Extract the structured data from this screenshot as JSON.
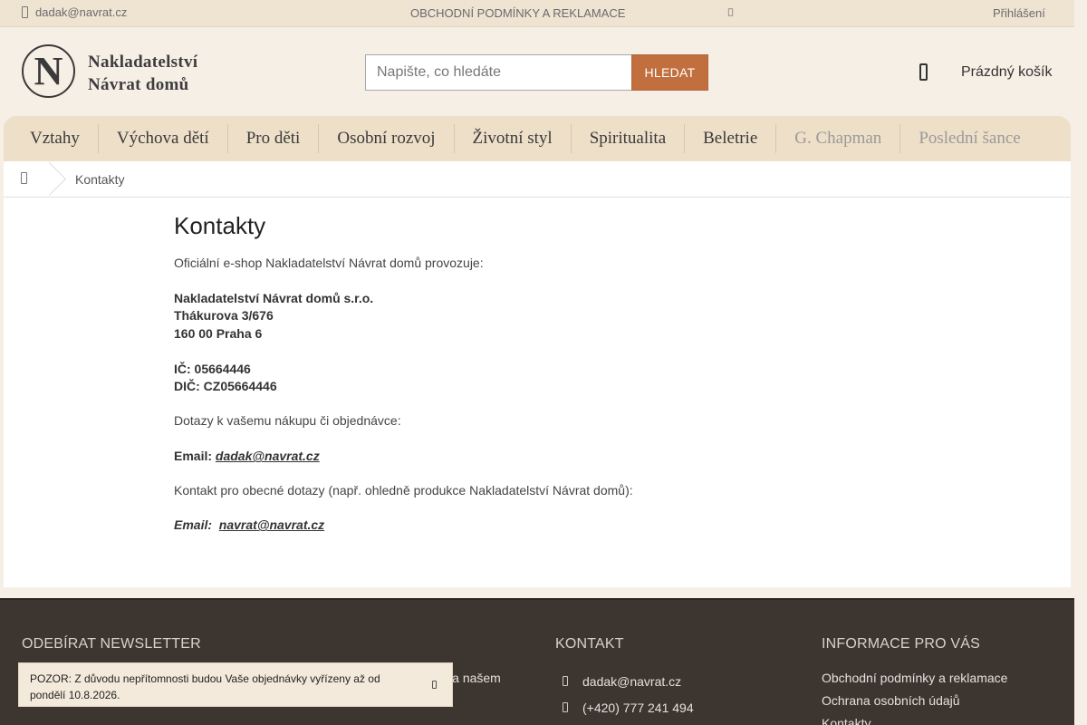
{
  "topbar": {
    "email": "dadak@navrat.cz",
    "terms": "OBCHODNÍ PODMÍNKY A REKLAMACE",
    "login": "Přihlášení"
  },
  "header": {
    "logo_letter": "N",
    "logo_line1": "Nakladatelství",
    "logo_line2": "Návrat domů",
    "search_placeholder": "Napište, co hledáte",
    "search_button": "HLEDAT",
    "cart_label": "Prázdný košík"
  },
  "nav": {
    "items": [
      {
        "label": "Vztahy"
      },
      {
        "label": "Výchova dětí"
      },
      {
        "label": "Pro děti"
      },
      {
        "label": "Osobní rozvoj"
      },
      {
        "label": "Životní styl"
      },
      {
        "label": "Spiritualita"
      },
      {
        "label": "Beletrie"
      },
      {
        "label": "G. Chapman"
      },
      {
        "label": "Poslední šance"
      }
    ]
  },
  "breadcrumb": {
    "current": "Kontakty"
  },
  "content": {
    "title": "Kontakty",
    "intro": "Oficiální e-shop Nakladatelství Návrat domů provozuje:",
    "company": "Nakladatelství Návrat domů s.r.o.",
    "street": "Thákurova 3/676",
    "city": "160 00 Praha 6",
    "ic": "IČ: 05664446",
    "dic": "DIČ: CZ05664446",
    "questions": "Dotazy k vašemu nákupu či objednávce:",
    "email_label": "Email:",
    "email1": "dadak@navrat.cz",
    "general": "Kontakt pro obecné dotazy (např. ohledně produkce Nakladatelství Návrat domů):",
    "email_label2": "Email:",
    "email2": "navrat@navrat.cz"
  },
  "footer": {
    "newsletter_title": "ODEBÍRAT NEWSLETTER",
    "newsletter_text_tail": "ktech na našem",
    "contact_title": "KONTAKT",
    "contact_email": "dadak@navrat.cz",
    "contact_phone": "(+420) 777 241 494",
    "info_title": "INFORMACE PRO VÁS",
    "info_links": [
      {
        "label": "Obchodní podmínky a reklamace"
      },
      {
        "label": "Ochrana osobních údajů"
      },
      {
        "label": "Kontakty"
      }
    ]
  },
  "notice": {
    "text": "POZOR: Z důvodu nepřítomnosti budou Vaše objednávky vyřízeny až od pondělí 10.8.2026."
  }
}
